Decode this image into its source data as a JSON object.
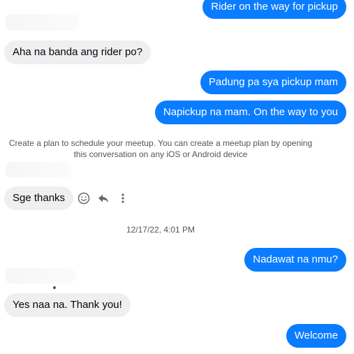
{
  "messages": {
    "m1": "Rider on the way for pickup",
    "m2": "Aha na banda ang rider po?",
    "m3": "Padung pa sya pickup mam",
    "m4": "Napickup na mam. On the way to you",
    "m5": "Sge thanks",
    "m6": "Nadawat na nmu?",
    "m7": "Yes naa na. Thank you!",
    "m8": "Welcome"
  },
  "system_notice": {
    "line1": "Create a plan to schedule your meetup. You can create a meetup plan by opening",
    "line2": "this conversation on any iOS or Android device"
  },
  "timestamp": "12/17/22, 4:01 PM",
  "message_actions": [
    "smiley-icon",
    "reply-icon",
    "more-icon"
  ],
  "colors": {
    "outgoing_bubble": "#0a7cff",
    "incoming_bubble": "#efeff1"
  }
}
